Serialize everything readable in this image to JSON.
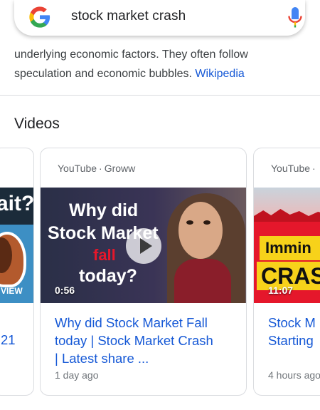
{
  "search": {
    "query": "stock market crash"
  },
  "snippet": {
    "line1": "underlying economic factors. They often follow",
    "line2": "speculation and economic bubbles.",
    "source_link": "Wikipedia"
  },
  "videos": {
    "section_title": "Videos",
    "left_card": {
      "thumb_text": "ait?",
      "badge_text": "VIEW",
      "title_fragment": "21"
    },
    "main_card": {
      "platform": "YouTube",
      "channel": "Groww",
      "thumb_lines": [
        "Why did",
        "Stock Market",
        "fall",
        "today?"
      ],
      "duration": "0:56",
      "title_line1": "Why did Stock Market Fall",
      "title_line2": "today | Stock Market Crash",
      "title_line3": "| Latest share ...",
      "age": "1 day ago"
    },
    "right_card": {
      "platform": "YouTube",
      "channel_fragment": "·",
      "thumb_word1": "Immin",
      "thumb_word2": "CRAS",
      "duration": "11:07",
      "title_line1": "Stock M",
      "title_line2": "Starting",
      "age": "4 hours ago"
    }
  },
  "colors": {
    "link": "#1558d6",
    "thumb_red": "#e5172b",
    "thumb_yellow": "#f7d21a",
    "play_overlay": "rgba(255,255,255,0.75)"
  }
}
